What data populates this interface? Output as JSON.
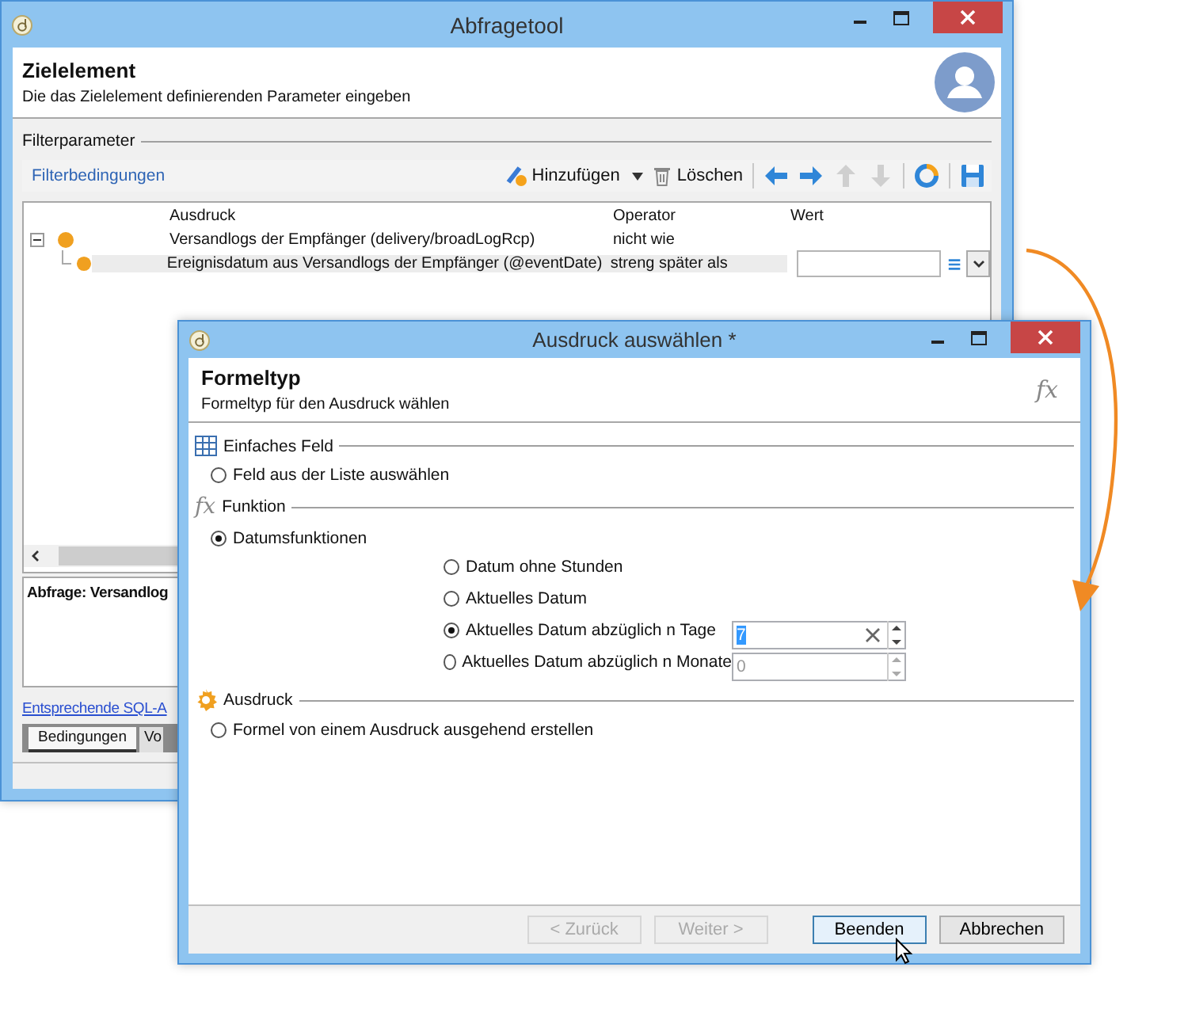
{
  "back_window": {
    "title": "Abfragetool",
    "header": {
      "title": "Zielelement",
      "subtitle": "Die das Zielelement definierenden Parameter eingeben"
    },
    "section": "Filterparameter",
    "toolbar": {
      "label": "Filterbedingungen",
      "buttons": [
        {
          "kind": "add",
          "label": "Hinzufügen",
          "disabled": false
        },
        {
          "kind": "delete",
          "label": "Löschen",
          "disabled": false
        },
        {
          "kind": "left",
          "disabled": false
        },
        {
          "kind": "right",
          "disabled": false
        },
        {
          "kind": "up",
          "disabled": true
        },
        {
          "kind": "down",
          "disabled": true
        },
        {
          "kind": "refresh",
          "disabled": false
        },
        {
          "kind": "save",
          "disabled": false
        }
      ]
    },
    "table": {
      "columns": [
        "Ausdruck",
        "Operator",
        "Wert"
      ],
      "rows": [
        {
          "expression": "Versandlogs der Empfänger (delivery/broadLogRcp)",
          "operator": "nicht wie",
          "selected": false,
          "expanded": true,
          "children": [
            {
              "expression": "Ereignisdatum aus Versandlogs der Empfänger (@eventDate)",
              "operator": "streng später als",
              "selected": true
            }
          ]
        }
      ]
    },
    "query_text": "Abfrage: Versandlog",
    "sql_link": "Entsprechende SQL-A",
    "tabs": [
      {
        "label": "Bedingungen",
        "selected": true
      },
      {
        "label": "Vo",
        "selected": false
      }
    ]
  },
  "dialog": {
    "title": "Ausdruck auswählen *",
    "header": {
      "title": "Formeltyp",
      "subtitle": "Formeltyp für den Ausdruck wählen",
      "icon_text": "fx"
    },
    "groups": [
      {
        "kind": "field",
        "label": "Einfaches Feld",
        "options": [
          {
            "label": "Feld aus der Liste auswählen",
            "selected": false
          }
        ]
      },
      {
        "kind": "function",
        "icon_text": "fx",
        "label": "Funktion",
        "options": [
          {
            "label": "Datumsfunktionen",
            "selected": true,
            "suboptions": [
              {
                "label": "Datum ohne Stunden",
                "selected": false
              },
              {
                "label": "Aktuelles Datum",
                "selected": false
              },
              {
                "label": "Aktuelles Datum abzüglich n Tage",
                "selected": true,
                "value": "7"
              },
              {
                "label": "Aktuelles Datum abzüglich n Monate",
                "selected": false,
                "value": "0"
              }
            ]
          }
        ]
      },
      {
        "kind": "expression",
        "label": "Ausdruck",
        "options": [
          {
            "label": "Formel von einem Ausdruck ausgehend erstellen",
            "selected": false
          }
        ]
      }
    ],
    "buttons": [
      {
        "label": "< Zurück",
        "disabled": true,
        "focused": false
      },
      {
        "label": "Weiter >",
        "disabled": true,
        "focused": false
      },
      {
        "label": "Beenden",
        "disabled": false,
        "focused": true
      },
      {
        "label": "Abbrechen",
        "disabled": false,
        "focused": false
      }
    ]
  }
}
